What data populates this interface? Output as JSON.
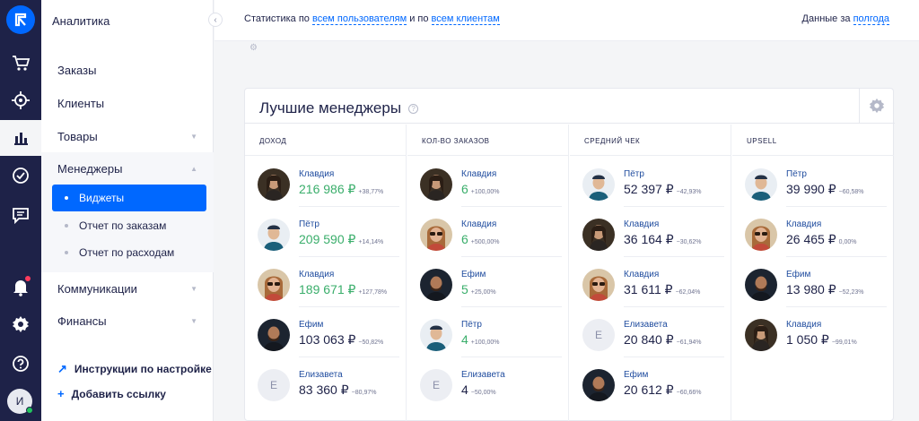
{
  "sidebar": {
    "title": "Аналитика",
    "items": [
      {
        "label": "Заказы"
      },
      {
        "label": "Клиенты"
      },
      {
        "label": "Товары"
      },
      {
        "label": "Менеджеры"
      },
      {
        "label": "Коммуникации"
      },
      {
        "label": "Финансы"
      }
    ],
    "subitems": [
      {
        "label": "Виджеты"
      },
      {
        "label": "Отчет по заказам"
      },
      {
        "label": "Отчет по расходам"
      }
    ],
    "links": [
      {
        "label": "Инструкции по настройке",
        "icon": "arrow-up-right-icon"
      },
      {
        "label": "Добавить ссылку",
        "icon": "plus-icon"
      }
    ],
    "user_initial": "И"
  },
  "header": {
    "stats_prefix": "Статистика по ",
    "stats_link1": "всем пользователям",
    "stats_mid": " и по ",
    "stats_link2": "всем клиентам",
    "period_prefix": "Данные за ",
    "period_link": "полгода"
  },
  "widget": {
    "title": "Лучшие менеджеры",
    "columns": [
      {
        "header": "Доход",
        "rows": [
          {
            "name": "Клавдия",
            "value": "216 986 ₽",
            "pct": "+38,77%",
            "avatar": "photo-woman-dark",
            "green": true
          },
          {
            "name": "Пётр",
            "value": "209 590 ₽",
            "pct": "+14,14%",
            "avatar": "photo-man-cap",
            "green": true
          },
          {
            "name": "Клавдия",
            "value": "189 671 ₽",
            "pct": "+127,78%",
            "avatar": "photo-woman-glasses",
            "green": true
          },
          {
            "name": "Ефим",
            "value": "103 063 ₽",
            "pct": "−50,82%",
            "avatar": "photo-man-dark",
            "green": false
          },
          {
            "name": "Елизавета",
            "value": "83 360 ₽",
            "pct": "−80,97%",
            "avatar": "letter",
            "letter": "Е",
            "green": false
          }
        ]
      },
      {
        "header": "Кол-во заказов",
        "rows": [
          {
            "name": "Клавдия",
            "value": "6",
            "pct": "+100,00%",
            "avatar": "photo-woman-dark",
            "green": true
          },
          {
            "name": "Клавдия",
            "value": "6",
            "pct": "+500,00%",
            "avatar": "photo-woman-glasses",
            "green": true
          },
          {
            "name": "Ефим",
            "value": "5",
            "pct": "+25,00%",
            "avatar": "photo-man-dark",
            "green": true
          },
          {
            "name": "Пётр",
            "value": "4",
            "pct": "+100,00%",
            "avatar": "photo-man-cap",
            "green": true
          },
          {
            "name": "Елизавета",
            "value": "4",
            "pct": "−50,00%",
            "avatar": "letter",
            "letter": "Е",
            "green": false
          }
        ]
      },
      {
        "header": "Средний чек",
        "rows": [
          {
            "name": "Пётр",
            "value": "52 397 ₽",
            "pct": "−42,93%",
            "avatar": "photo-man-cap",
            "green": false
          },
          {
            "name": "Клавдия",
            "value": "36 164 ₽",
            "pct": "−30,62%",
            "avatar": "photo-woman-dark",
            "green": false
          },
          {
            "name": "Клавдия",
            "value": "31 611 ₽",
            "pct": "−62,04%",
            "avatar": "photo-woman-glasses",
            "green": false
          },
          {
            "name": "Елизавета",
            "value": "20 840 ₽",
            "pct": "−61,94%",
            "avatar": "letter",
            "letter": "Е",
            "green": false
          },
          {
            "name": "Ефим",
            "value": "20 612 ₽",
            "pct": "−60,66%",
            "avatar": "photo-man-dark",
            "green": false
          }
        ]
      },
      {
        "header": "Upsell",
        "rows": [
          {
            "name": "Пётр",
            "value": "39 990 ₽",
            "pct": "−60,58%",
            "avatar": "photo-man-cap",
            "green": false
          },
          {
            "name": "Клавдия",
            "value": "26 465 ₽",
            "pct": "0,00%",
            "avatar": "photo-woman-glasses",
            "green": false
          },
          {
            "name": "Ефим",
            "value": "13 980 ₽",
            "pct": "−52,23%",
            "avatar": "photo-man-dark",
            "green": false
          },
          {
            "name": "Клавдия",
            "value": "1 050 ₽",
            "pct": "−99,01%",
            "avatar": "photo-woman-dark",
            "green": false
          }
        ]
      }
    ]
  },
  "colors": {
    "accent": "#0068ff",
    "nav": "#1e2248",
    "positive": "#3aae6b"
  }
}
